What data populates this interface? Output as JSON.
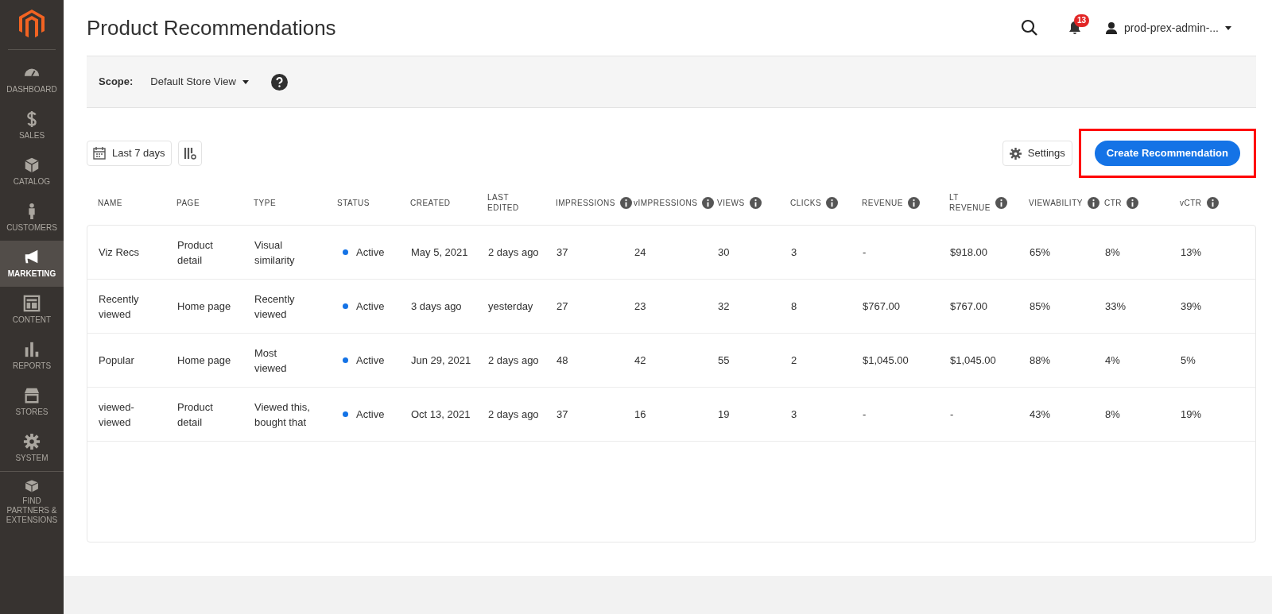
{
  "sidebar": {
    "items": [
      {
        "label": "DASHBOARD",
        "selected": false
      },
      {
        "label": "SALES",
        "selected": false
      },
      {
        "label": "CATALOG",
        "selected": false
      },
      {
        "label": "CUSTOMERS",
        "selected": false
      },
      {
        "label": "MARKETING",
        "selected": true
      },
      {
        "label": "CONTENT",
        "selected": false
      },
      {
        "label": "REPORTS",
        "selected": false
      },
      {
        "label": "STORES",
        "selected": false
      },
      {
        "label": "SYSTEM",
        "selected": false
      },
      {
        "label": "FIND PARTNERS & EXTENSIONS",
        "selected": false
      }
    ]
  },
  "header": {
    "title": "Product Recommendations",
    "notifications": "13",
    "user": "prod-prex-admin-..."
  },
  "scope": {
    "label": "Scope:",
    "value": "Default Store View"
  },
  "toolbar": {
    "date_range": "Last 7 days",
    "settings": "Settings",
    "create_button": "Create Recommendation",
    "create_highlighted": true
  },
  "table": {
    "columns": [
      {
        "label": "NAME",
        "info": false
      },
      {
        "label": "PAGE",
        "info": false
      },
      {
        "label": "TYPE",
        "info": false
      },
      {
        "label": "STATUS",
        "info": false
      },
      {
        "label": "CREATED",
        "info": false
      },
      {
        "label": "LAST EDITED",
        "info": false
      },
      {
        "label": "IMPRESSIONS",
        "info": true
      },
      {
        "label": "vIMPRESSIONS",
        "info": true
      },
      {
        "label": "VIEWS",
        "info": true
      },
      {
        "label": "CLICKS",
        "info": true
      },
      {
        "label": "REVENUE",
        "info": true
      },
      {
        "label": "LT REVENUE",
        "info": true
      },
      {
        "label": "VIEWABILITY",
        "info": true
      },
      {
        "label": "CTR",
        "info": true
      },
      {
        "label": "vCTR",
        "info": true
      }
    ],
    "rows": [
      [
        "Viz Recs",
        "Product detail",
        "Visual similarity",
        "Active",
        "May 5, 2021",
        "2 days ago",
        "37",
        "24",
        "30",
        "3",
        "-",
        "$918.00",
        "65%",
        "8%",
        "13%"
      ],
      [
        "Recently viewed",
        "Home page",
        "Recently viewed",
        "Active",
        "3 days ago",
        "yesterday",
        "27",
        "23",
        "32",
        "8",
        "$767.00",
        "$767.00",
        "85%",
        "33%",
        "39%"
      ],
      [
        "Popular",
        "Home page",
        "Most viewed",
        "Active",
        "Jun 29, 2021",
        "2 days ago",
        "48",
        "42",
        "55",
        "2",
        "$1,045.00",
        "$1,045.00",
        "88%",
        "4%",
        "5%"
      ],
      [
        "viewed-viewed",
        "Product detail",
        "Viewed this, bought that",
        "Active",
        "Oct 13, 2021",
        "2 days ago",
        "37",
        "16",
        "19",
        "3",
        "-",
        "-",
        "43%",
        "8%",
        "19%"
      ]
    ]
  }
}
